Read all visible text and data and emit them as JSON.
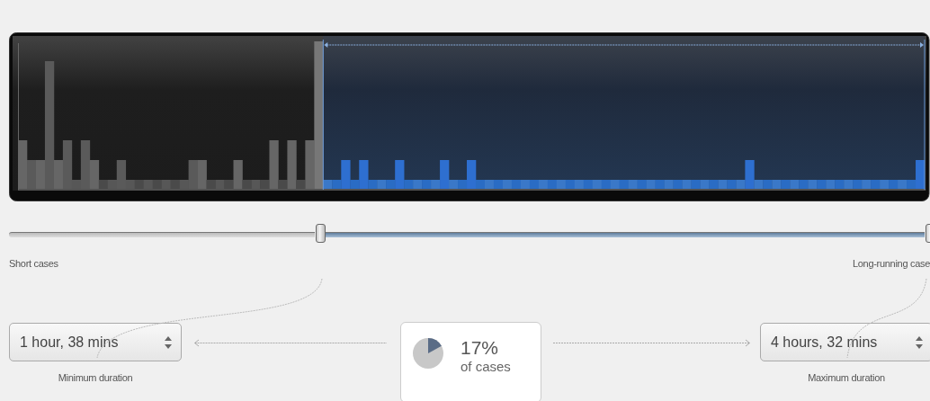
{
  "range_slider": {
    "thumbs": [
      {
        "level": 0.338
      },
      {
        "level": 1.0
      }
    ],
    "left_label": "Short cases",
    "right_label": "Long-running case"
  },
  "minimum": {
    "value": "1 hour, 38 mins",
    "caption": "Minimum duration"
  },
  "summary": {
    "percent": "17%",
    "caption": "of cases",
    "level": 0.17
  },
  "maximum": {
    "value": "4 hours, 32 mins",
    "caption": "Maximum duration"
  }
}
